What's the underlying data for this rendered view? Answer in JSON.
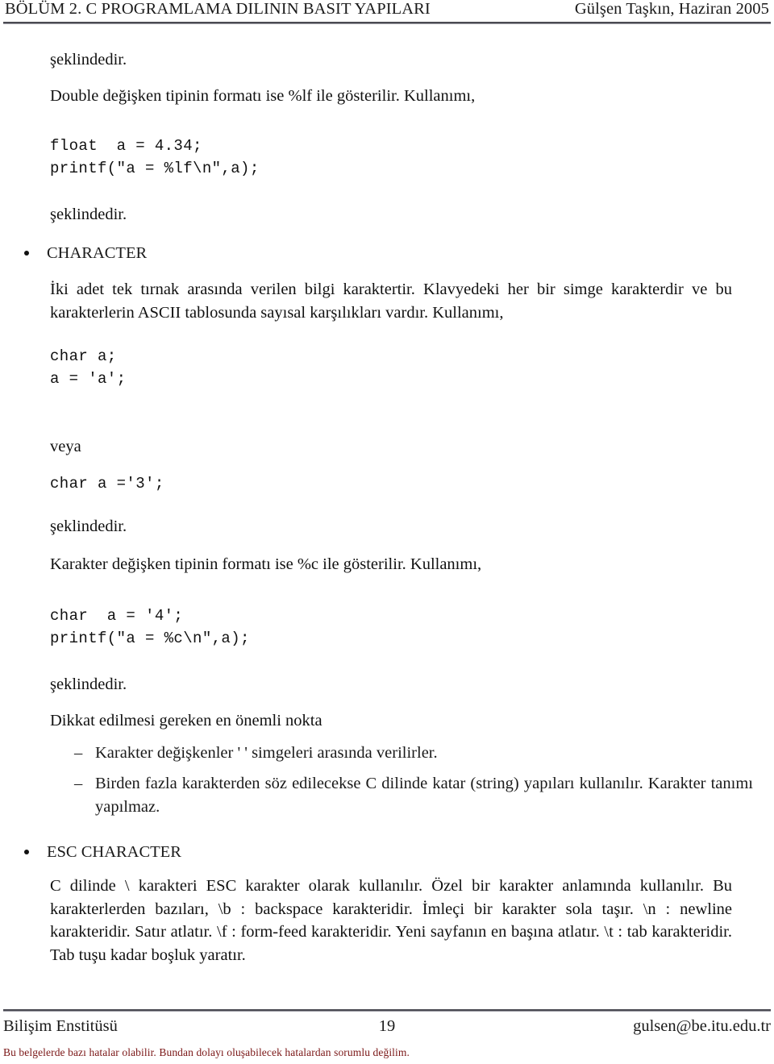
{
  "header": {
    "left": "BÖLÜM 2.  C PROGRAMLAMA DILININ BASIT YAPILARI",
    "right": "Gülşen Taşkın, Haziran 2005"
  },
  "body": {
    "p1": "şeklindedir.",
    "p2": "Double değişken tipinin formatı ise %lf ile gösterilir. Kullanımı,",
    "code1": "float  a = 4.34;\nprintf(\"a = %lf\\n\",a);",
    "p3": "şeklindedir.",
    "bullet1": "CHARACTER",
    "p4": "İki adet tek tırnak arasında verilen bilgi karaktertir. Klavyedeki her bir simge karakterdir ve bu karakterlerin ASCII tablosunda sayısal karşılıkları vardır. Kullanımı,",
    "code2": "char a;\na = 'a';",
    "p5": "veya",
    "code3": "char a ='3';",
    "p6": "şeklindedir.",
    "p7": "Karakter değişken tipinin formatı ise %c ile gösterilir. Kullanımı,",
    "code4": "char  a = '4';\nprintf(\"a = %c\\n\",a);",
    "p8": "şeklindedir.",
    "p9": "Dikkat edilmesi gereken en önemli nokta",
    "dash_mark": "–",
    "dash1": "Karakter değişkenler ' ' simgeleri arasında verilirler.",
    "dash2": "Birden fazla karakterden söz edilecekse C dilinde katar (string) yapıları kullanılır. Karakter tanımı yapılmaz.",
    "bullet2": "ESC CHARACTER",
    "p10": "C dilinde \\ karakteri ESC karakter olarak kullanılır. Özel bir karakter anlamında kullanılır. Bu karakterlerden bazıları, \\b : backspace karakteridir. İmleçi bir karakter sola taşır. \\n : newline karakteridir. Satır atlatır. \\f : form-feed karakteridir. Yeni sayfanın en başına atlatır. \\t : tab karakteridir. Tab tuşu kadar boşluk yaratır."
  },
  "footer": {
    "left": "Bilişim Enstitüsü",
    "page_number": "19",
    "right": "gulsen@be.itu.edu.tr",
    "disclaimer": "Bu belgelerde bazı hatalar olabilir. Bundan dolayı oluşabilecek hatalardan sorumlu değilim."
  },
  "colors": {
    "text": "#111111",
    "rule": "#4a4a52",
    "disclaimer": "#7a1616"
  }
}
